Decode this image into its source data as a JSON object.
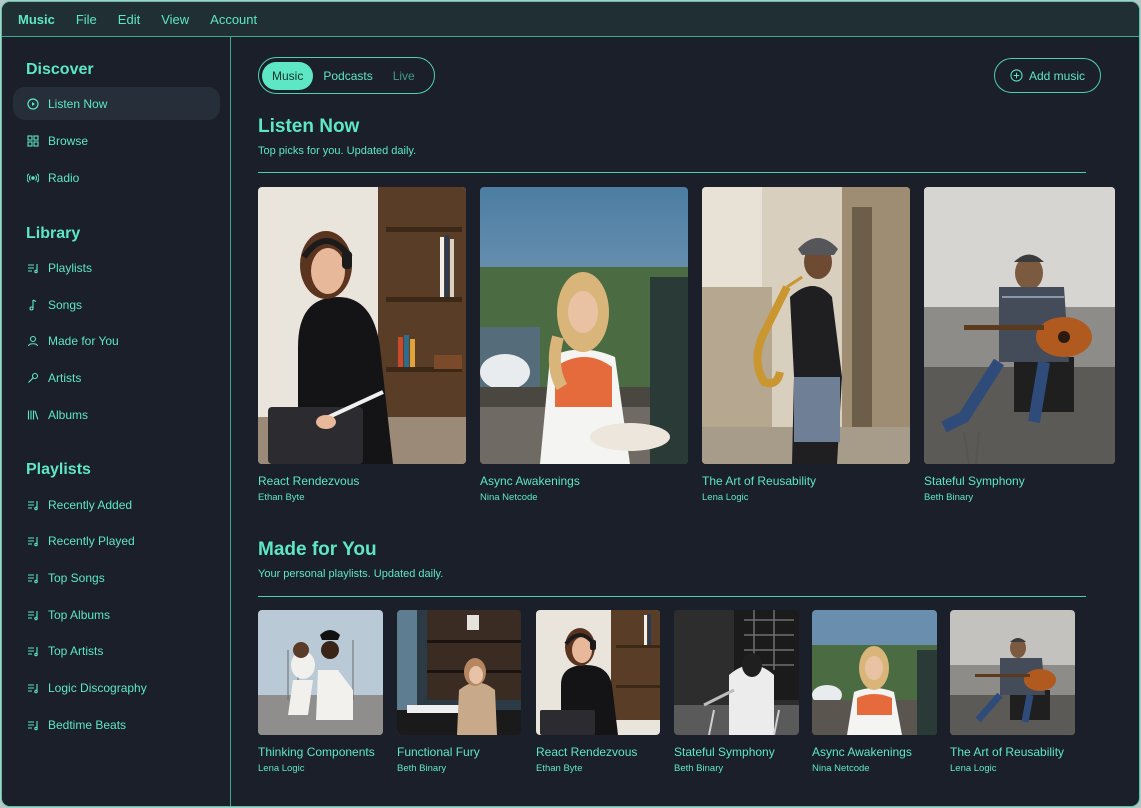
{
  "menubar": {
    "items": [
      "Music",
      "File",
      "Edit",
      "View",
      "Account"
    ]
  },
  "sidebar": {
    "discover": {
      "title": "Discover",
      "items": [
        "Listen Now",
        "Browse",
        "Radio"
      ]
    },
    "library": {
      "title": "Library",
      "items": [
        "Playlists",
        "Songs",
        "Made for You",
        "Artists",
        "Albums"
      ]
    },
    "playlists": {
      "title": "Playlists",
      "items": [
        "Recently Added",
        "Recently Played",
        "Top Songs",
        "Top Albums",
        "Top Artists",
        "Logic Discography",
        "Bedtime Beats"
      ]
    }
  },
  "tabs": [
    "Music",
    "Podcasts",
    "Live"
  ],
  "add_music_label": "Add music",
  "listen_now": {
    "title": "Listen Now",
    "subtitle": "Top picks for you. Updated daily.",
    "albums": [
      {
        "title": "React Rendezvous",
        "artist": "Ethan Byte"
      },
      {
        "title": "Async Awakenings",
        "artist": "Nina Netcode"
      },
      {
        "title": "The Art of Reusability",
        "artist": "Lena Logic"
      },
      {
        "title": "Stateful Symphony",
        "artist": "Beth Binary"
      }
    ]
  },
  "made_for_you": {
    "title": "Made for You",
    "subtitle": "Your personal playlists. Updated daily.",
    "albums": [
      {
        "title": "Thinking Components",
        "artist": "Lena Logic"
      },
      {
        "title": "Functional Fury",
        "artist": "Beth Binary"
      },
      {
        "title": "React Rendezvous",
        "artist": "Ethan Byte"
      },
      {
        "title": "Stateful Symphony",
        "artist": "Beth Binary"
      },
      {
        "title": "Async Awakenings",
        "artist": "Nina Netcode"
      },
      {
        "title": "The Art of Reusability",
        "artist": "Lena Logic"
      }
    ]
  },
  "colors": {
    "accent": "#5de7c4",
    "background": "#1b1f2a",
    "menubar": "#1f2f34"
  }
}
